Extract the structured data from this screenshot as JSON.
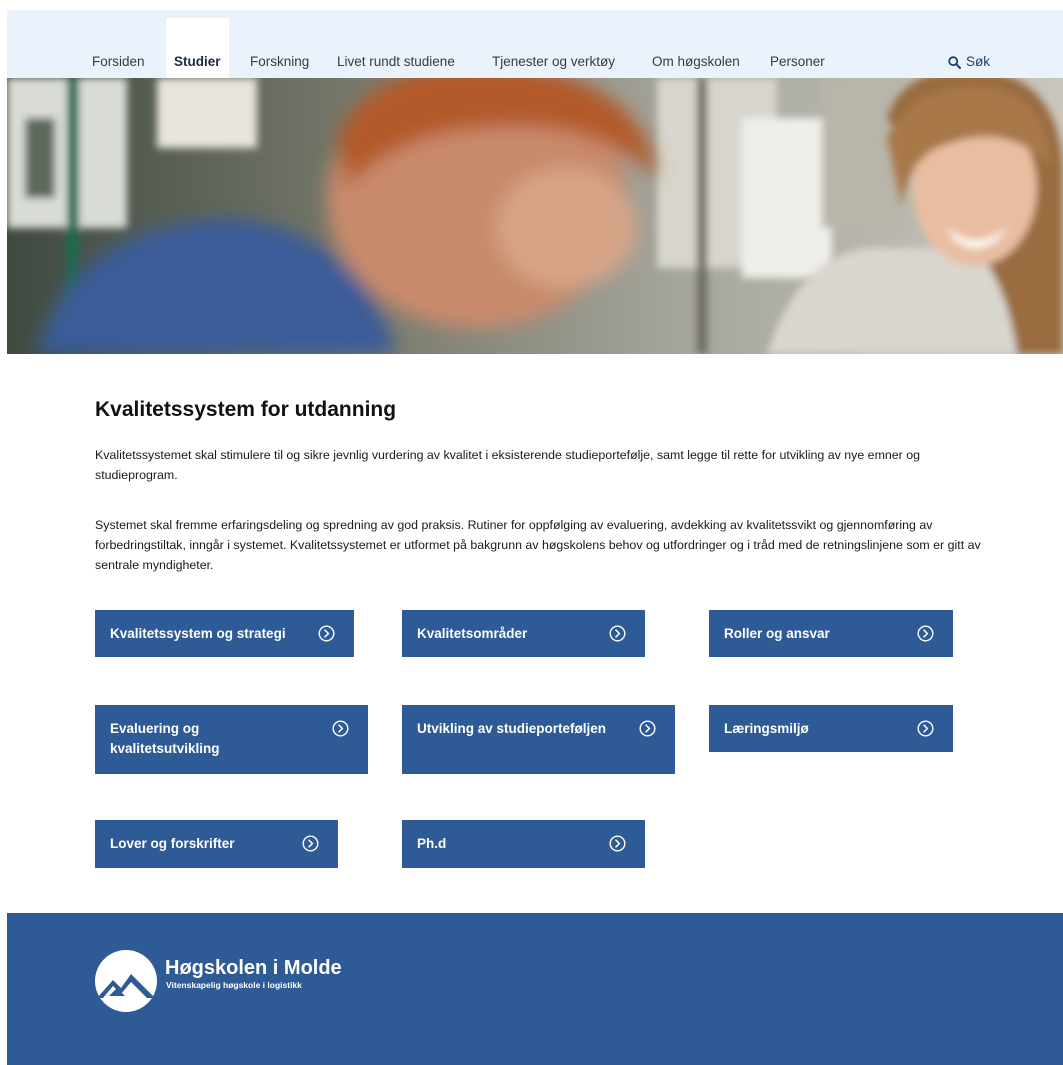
{
  "nav": {
    "items": [
      {
        "label": "Forsiden",
        "active": false
      },
      {
        "label": "Studier",
        "active": true
      },
      {
        "label": "Forskning",
        "active": false
      },
      {
        "label": "Livet rundt studiene",
        "active": false
      },
      {
        "label": "Tjenester og verktøy",
        "active": false
      },
      {
        "label": "Om høgskolen",
        "active": false
      },
      {
        "label": "Personer",
        "active": false
      }
    ],
    "search_label": "Søk"
  },
  "main": {
    "title": "Kvalitetssystem for utdanning",
    "paragraphs": [
      "Kvalitetssystemet skal stimulere til og sikre jevnlig vurdering av kvalitet i eksisterende studieportefølje, samt legge til rette for utvikling av nye emner og studieprogram.",
      "Systemet skal fremme erfaringsdeling og spredning av god praksis. Rutiner for oppfølging av evaluering, avdekking av kvalitetssvikt og gjennomføring av forbedringstiltak, inngår i systemet. Kvalitetssystemet er utformet på bakgrunn av høgskolens behov og utfordringer og i tråd med de retningslinjene som er gitt av sentrale myndigheter."
    ],
    "cards": [
      {
        "label": "Kvalitetssystem og strategi"
      },
      {
        "label": "Kvalitetsområder"
      },
      {
        "label": "Roller og ansvar"
      },
      {
        "label": "Evaluering og kvalitetsutvikling"
      },
      {
        "label": "Utvikling av studieporteføljen"
      },
      {
        "label": "Læringsmiljø"
      },
      {
        "label": "Lover og forskrifter"
      },
      {
        "label": "Ph.d"
      }
    ]
  },
  "footer": {
    "logo_name": "Høgskolen i Molde",
    "logo_tagline": "Vitenskapelig høgskole i logistikk"
  },
  "colors": {
    "nav_background": "#eaf2fb",
    "card_background": "#2e5a96",
    "footer_background": "#2e5a96",
    "search_color": "#1f3e6e"
  },
  "icons": {
    "search": "search-icon",
    "card_arrow": "arrow-circle-right-icon",
    "logo": "mountain-logo-icon"
  }
}
